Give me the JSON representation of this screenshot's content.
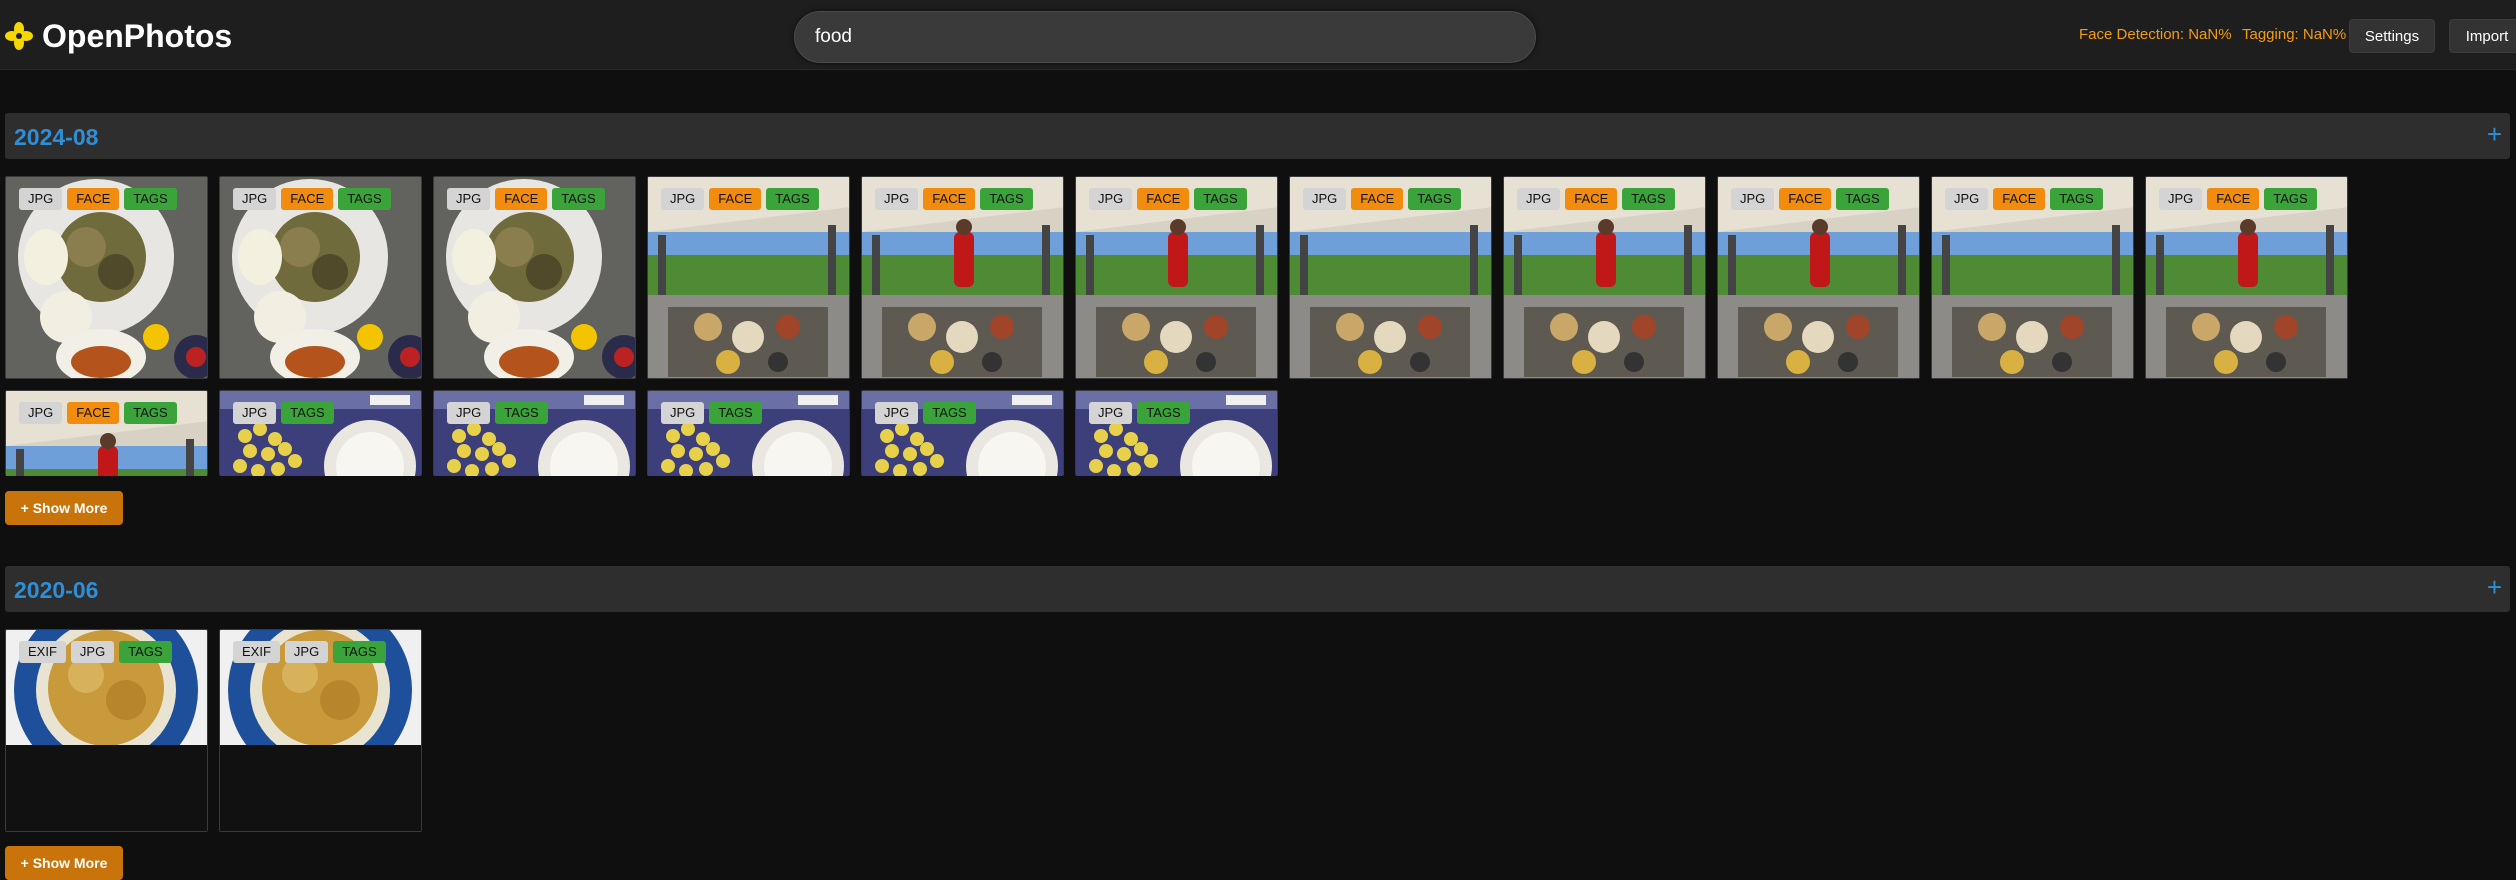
{
  "app": {
    "title": "OpenPhotos"
  },
  "search": {
    "value": "food"
  },
  "status": {
    "face_detection": "Face Detection: NaN%",
    "tagging": "Tagging: NaN%"
  },
  "toolbar": {
    "settings_label": "Settings",
    "import_label": "Import"
  },
  "colors": {
    "accent": "#2e8fd6",
    "warning": "#f39c12",
    "face_badge": "#f28c0f",
    "tags_badge": "#3aa43a",
    "show_more": "#c8740a"
  },
  "sections": [
    {
      "title": "2024-08",
      "expand_icon": "+",
      "show_more_label": "+ Show More",
      "photos": [
        {
          "kind": "plate",
          "badges": [
            "JPG",
            "FACE",
            "TAGS"
          ]
        },
        {
          "kind": "plate",
          "badges": [
            "JPG",
            "FACE",
            "TAGS"
          ]
        },
        {
          "kind": "plate",
          "badges": [
            "JPG",
            "FACE",
            "TAGS"
          ]
        },
        {
          "kind": "patio",
          "badges": [
            "JPG",
            "FACE",
            "TAGS"
          ]
        },
        {
          "kind": "patio-person",
          "badges": [
            "JPG",
            "FACE",
            "TAGS"
          ]
        },
        {
          "kind": "patio-person",
          "badges": [
            "JPG",
            "FACE",
            "TAGS"
          ]
        },
        {
          "kind": "patio",
          "badges": [
            "JPG",
            "FACE",
            "TAGS"
          ]
        },
        {
          "kind": "patio-person",
          "badges": [
            "JPG",
            "FACE",
            "TAGS"
          ]
        },
        {
          "kind": "patio-person",
          "badges": [
            "JPG",
            "FACE",
            "TAGS"
          ]
        },
        {
          "kind": "patio",
          "badges": [
            "JPG",
            "FACE",
            "TAGS"
          ]
        },
        {
          "kind": "patio-person",
          "badges": [
            "JPG",
            "FACE",
            "TAGS"
          ]
        },
        {
          "kind": "patio-person",
          "badges": [
            "JPG",
            "FACE",
            "TAGS"
          ]
        },
        {
          "kind": "snack",
          "badges": [
            "JPG",
            "TAGS"
          ]
        },
        {
          "kind": "snack",
          "badges": [
            "JPG",
            "TAGS"
          ]
        },
        {
          "kind": "snack",
          "badges": [
            "JPG",
            "TAGS"
          ]
        },
        {
          "kind": "snack",
          "badges": [
            "JPG",
            "TAGS"
          ]
        },
        {
          "kind": "snack",
          "badges": [
            "JPG",
            "TAGS"
          ]
        }
      ]
    },
    {
      "title": "2020-06",
      "expand_icon": "+",
      "show_more_label": "+ Show More",
      "photos": [
        {
          "kind": "blueplate",
          "badges": [
            "EXIF",
            "JPG",
            "TAGS"
          ]
        },
        {
          "kind": "blueplate",
          "badges": [
            "EXIF",
            "JPG",
            "TAGS"
          ]
        }
      ]
    }
  ]
}
